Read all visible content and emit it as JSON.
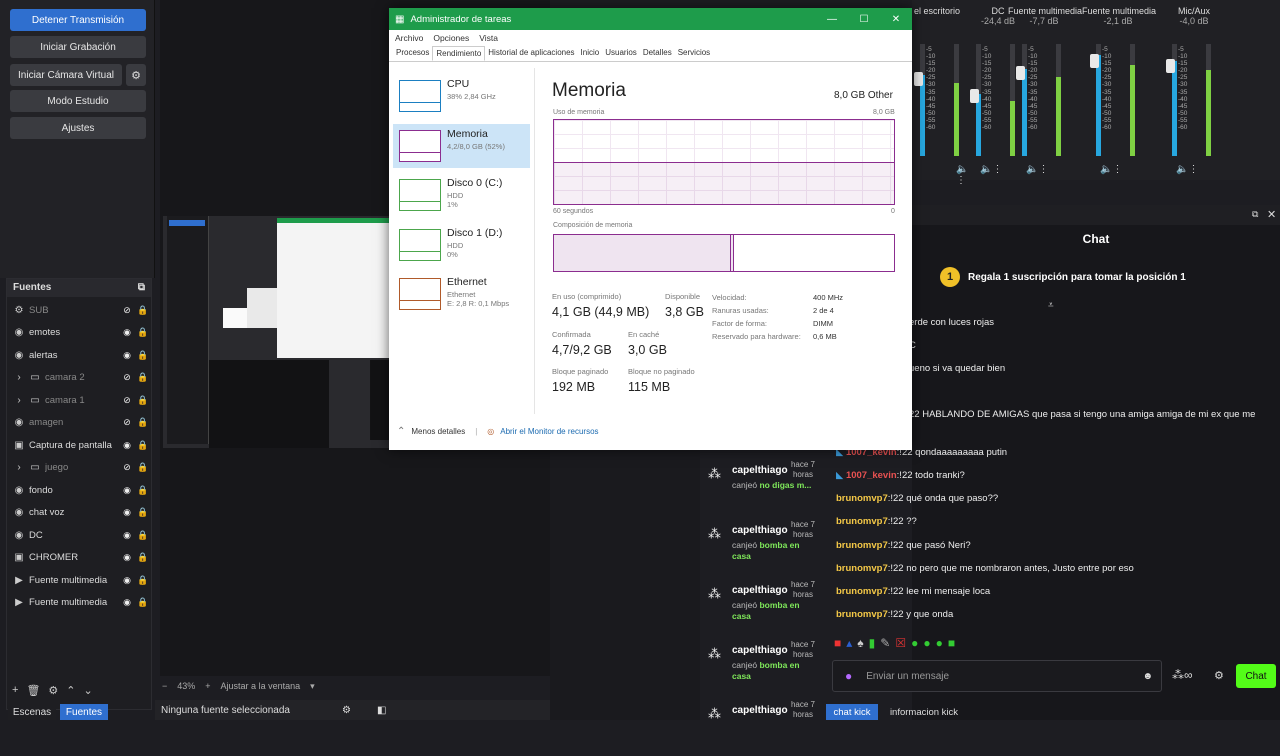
{
  "obs": {
    "controls": {
      "stop_stream": "Detener Transmisión",
      "start_recording": "Iniciar Grabación",
      "start_virtual_cam": "Iniciar Cámara Virtual",
      "studio_mode": "Modo Estudio",
      "settings": "Ajustes"
    },
    "sources": {
      "title": "Fuentes",
      "items": [
        {
          "name": "SUB",
          "icon": "gear-icon",
          "dim": true
        },
        {
          "name": "emotes",
          "icon": "globe-icon",
          "dim": false
        },
        {
          "name": "alertas",
          "icon": "globe-icon",
          "dim": false
        },
        {
          "name": "camara 2",
          "icon": "folder-icon",
          "dim": true
        },
        {
          "name": "camara 1",
          "icon": "folder-icon",
          "dim": true
        },
        {
          "name": "amagen",
          "icon": "globe-icon",
          "dim": true
        },
        {
          "name": "Captura de pantalla",
          "icon": "monitor-icon",
          "dim": false
        },
        {
          "name": "juego",
          "icon": "folder-icon",
          "dim": true
        },
        {
          "name": "fondo",
          "icon": "globe-icon",
          "dim": false
        },
        {
          "name": "chat voz",
          "icon": "globe-icon",
          "dim": false
        },
        {
          "name": "DC",
          "icon": "globe-icon",
          "dim": false
        },
        {
          "name": "CHROMER",
          "icon": "window-icon",
          "dim": false
        },
        {
          "name": "Fuente multimedia",
          "icon": "play-icon",
          "dim": false
        },
        {
          "name": "Fuente multimedia",
          "icon": "play-icon",
          "dim": false
        }
      ]
    },
    "tabs": {
      "scenes": "Escenas",
      "sources": "Fuentes"
    },
    "zoom": "43%",
    "fit": "Ajustar a la ventana",
    "status": "Ninguna fuente seleccionada",
    "mixer": [
      {
        "name": "el escritorio",
        "db": "",
        "level": 0.72
      },
      {
        "name": "DC",
        "db": "-24,4 dB",
        "level": 0.55
      },
      {
        "name": "Fuente multimedia",
        "db": "-7,7 dB",
        "level": 0.78
      },
      {
        "name": "Fuente multimedia",
        "db": "-2,1 dB",
        "level": 0.9
      },
      {
        "name": "Mic/Aux",
        "db": "-4,0 dB",
        "level": 0.85
      }
    ],
    "scale": [
      "-5",
      "-10",
      "-15",
      "-20",
      "-25",
      "-30",
      "-35",
      "-40",
      "-45",
      "-50",
      "-55",
      "-60"
    ]
  },
  "chat": {
    "title": "Chat",
    "gift_text": "Regala 1 suscripción para tomar la posición 1",
    "messages": [
      {
        "user": "",
        "text": "erde con luces rojas"
      },
      {
        "user": "",
        "text": "C"
      },
      {
        "user": "",
        "text": "ueno si va quedar bien"
      },
      {
        "user": "",
        "text": "22 HABLANDO DE AMIGAS que pasa si tengo una amiga amiga de mi ex que me"
      },
      {
        "user": "1007_kevin",
        "text": ":!22 qondaaaaaaaaa putin"
      },
      {
        "user": "1007_kevin",
        "text": ":!22 todo tranki?"
      },
      {
        "user": "brunomvp7",
        "text": ":!22 qué onda que paso??"
      },
      {
        "user": "brunomvp7",
        "text": ":!22 ??"
      },
      {
        "user": "brunomvp7",
        "text": ":!22 que pasó Neri?"
      },
      {
        "user": "brunomvp7",
        "text": ":!22 no pero que me nombraron antes, Justo entre por eso"
      },
      {
        "user": "brunomvp7",
        "text": ":!22 lee mi mensaje loca"
      },
      {
        "user": "brunomvp7",
        "text": ":!22 y que onda"
      }
    ],
    "subs": [
      {
        "name": "capelthiago",
        "time": "hace 7 horas",
        "prefix": "canjeó",
        "reward": "no digas m..."
      },
      {
        "name": "capelthiago",
        "time": "hace 7 horas",
        "prefix": "canjeó",
        "reward": "bomba en casa"
      },
      {
        "name": "capelthiago",
        "time": "hace 7 horas",
        "prefix": "canjeó",
        "reward": "bomba en casa"
      },
      {
        "name": "capelthiago",
        "time": "hace 7 horas",
        "prefix": "canjeó",
        "reward": "bomba en casa"
      },
      {
        "name": "capelthiago",
        "time": "hace 7 horas",
        "prefix": "",
        "reward": ""
      }
    ],
    "input_placeholder": "Enviar un mensaje",
    "send_label": "Chat",
    "bottom_tabs": [
      "chat kick",
      "informacion kick"
    ]
  },
  "taskmgr": {
    "title": "Administrador de tareas",
    "menu": [
      "Archivo",
      "Opciones",
      "Vista"
    ],
    "tabs": [
      "Procesos",
      "Rendimiento",
      "Historial de aplicaciones",
      "Inicio",
      "Usuarios",
      "Detalles",
      "Servicios"
    ],
    "side": [
      {
        "label": "CPU",
        "sub": "38% 2,84 GHz",
        "color": "#1b7fc1"
      },
      {
        "label": "Memoria",
        "sub": "4,2/8,0 GB (52%)",
        "color": "#8b2d8f"
      },
      {
        "label": "Disco 0 (C:)",
        "sub": "HDD\n1%",
        "color": "#4ca64c"
      },
      {
        "label": "Disco 1 (D:)",
        "sub": "HDD\n0%",
        "color": "#4ca64c"
      },
      {
        "label": "Ethernet",
        "sub": "Ethernet\nE: 2,8 R: 0,1 Mbps",
        "color": "#b05a2a"
      }
    ],
    "main": {
      "title": "Memoria",
      "total": "8,0 GB Other",
      "usage_label": "Uso de memoria",
      "usage_max": "8,0 GB",
      "time_label": "60 segundos",
      "time_end": "0",
      "composition_label": "Composición de memoria",
      "stats": {
        "in_use_label": "En uso (comprimido)",
        "in_use": "4,1 GB (44,9 MB)",
        "available_label": "Disponible",
        "available": "3,8 GB",
        "committed_label": "Confirmada",
        "committed": "4,7/9,2 GB",
        "cached_label": "En caché",
        "cached": "3,0 GB",
        "paged_label": "Bloque paginado",
        "paged": "192 MB",
        "nonpaged_label": "Bloque no paginado",
        "nonpaged": "115 MB"
      },
      "details": [
        {
          "k": "Velocidad:",
          "v": "400 MHz"
        },
        {
          "k": "Ranuras usadas:",
          "v": "2 de 4"
        },
        {
          "k": "Factor de forma:",
          "v": "DIMM"
        },
        {
          "k": "Reservado para hardware:",
          "v": "0,6 MB"
        }
      ]
    },
    "less_details": "Menos detalles",
    "open_monitor": "Abrir el Monitor de recursos"
  }
}
